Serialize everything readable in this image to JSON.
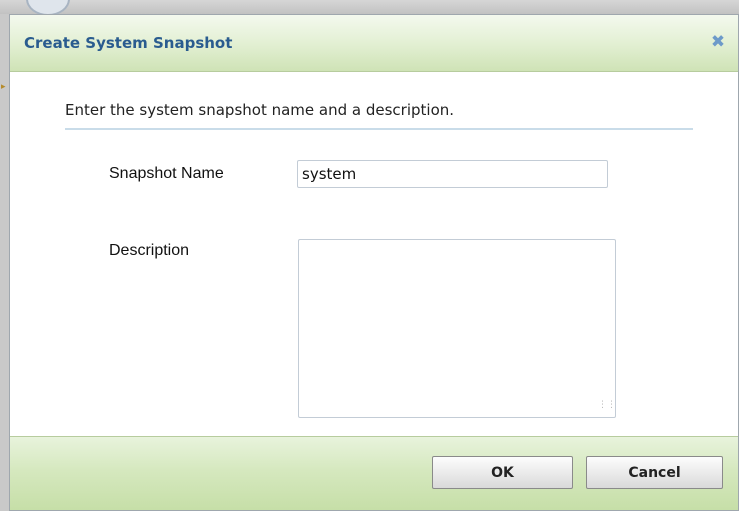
{
  "dialog": {
    "title": "Create System Snapshot",
    "close_icon": "close-icon",
    "intro": "Enter the system snapshot name and a description.",
    "fields": {
      "name_label": "Snapshot Name",
      "name_value": "system",
      "description_label": "Description",
      "description_value": ""
    },
    "buttons": {
      "ok": "OK",
      "cancel": "Cancel"
    }
  },
  "colors": {
    "title_text": "#2a5c8f",
    "header_green": "#cfe3b6",
    "close_icon": "#6d9ac9"
  }
}
